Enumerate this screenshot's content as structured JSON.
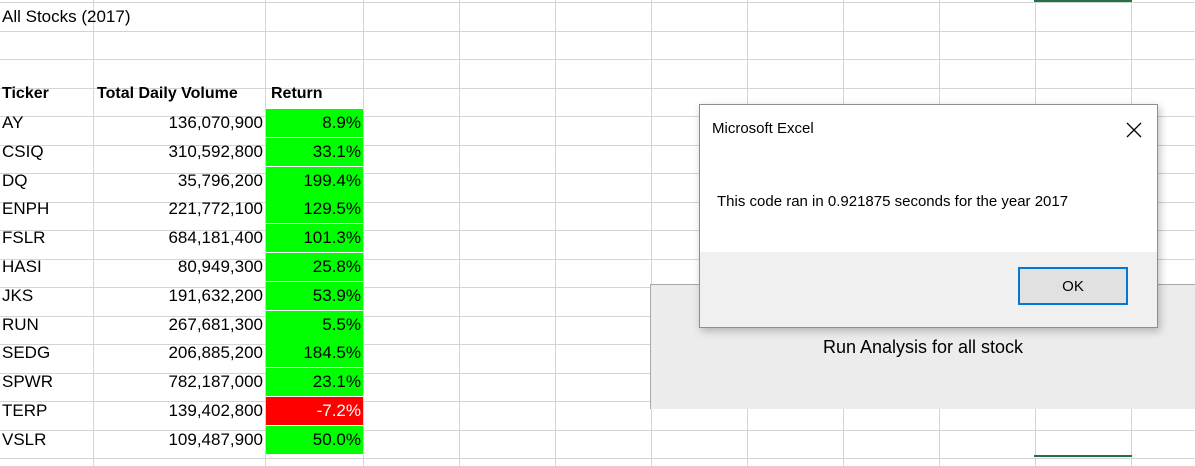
{
  "sheet": {
    "title": "All Stocks (2017)",
    "headers": {
      "ticker": "Ticker",
      "volume": "Total Daily Volume",
      "return": "Return"
    },
    "rows": [
      {
        "ticker": "AY",
        "volume": "136,070,900",
        "return": "8.9%",
        "status": "positive"
      },
      {
        "ticker": "CSIQ",
        "volume": "310,592,800",
        "return": "33.1%",
        "status": "positive"
      },
      {
        "ticker": "DQ",
        "volume": "35,796,200",
        "return": "199.4%",
        "status": "positive"
      },
      {
        "ticker": "ENPH",
        "volume": "221,772,100",
        "return": "129.5%",
        "status": "positive"
      },
      {
        "ticker": "FSLR",
        "volume": "684,181,400",
        "return": "101.3%",
        "status": "positive"
      },
      {
        "ticker": "HASI",
        "volume": "80,949,300",
        "return": "25.8%",
        "status": "positive"
      },
      {
        "ticker": "JKS",
        "volume": "191,632,200",
        "return": "53.9%",
        "status": "positive"
      },
      {
        "ticker": "RUN",
        "volume": "267,681,300",
        "return": "5.5%",
        "status": "positive"
      },
      {
        "ticker": "SEDG",
        "volume": "206,885,200",
        "return": "184.5%",
        "status": "positive"
      },
      {
        "ticker": "SPWR",
        "volume": "782,187,000",
        "return": "23.1%",
        "status": "positive"
      },
      {
        "ticker": "TERP",
        "volume": "139,402,800",
        "return": "-7.2%",
        "status": "negative"
      },
      {
        "ticker": "VSLR",
        "volume": "109,487,900",
        "return": "50.0%",
        "status": "positive"
      }
    ]
  },
  "run_button": {
    "label": "Run Analysis for all stock"
  },
  "dialog": {
    "title": "Microsoft Excel",
    "message": "This code ran in 0.921875 seconds for the year 2017",
    "ok_label": "OK",
    "close_icon": "close-icon"
  },
  "colors": {
    "positive": "#00ff00",
    "negative": "#ff0000",
    "gridline": "#d4d4d4",
    "selection": "#217346",
    "focus": "#0078d7"
  }
}
